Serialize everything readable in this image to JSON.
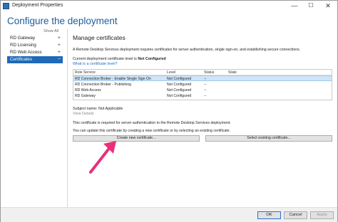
{
  "window": {
    "title": "Deployment Properties",
    "min_glyph": "—",
    "max_glyph": "☐",
    "close_glyph": "✕"
  },
  "page_title": "Configure the deployment",
  "nav": {
    "show_all": "Show All",
    "items": [
      {
        "label": "RD Gateway",
        "glyph": "+"
      },
      {
        "label": "RD Licensing",
        "glyph": "+"
      },
      {
        "label": "RD Web Access",
        "glyph": "+"
      },
      {
        "label": "Certificates",
        "glyph": "−"
      }
    ]
  },
  "main": {
    "section_title": "Manage certificates",
    "description": "A Remote Desktop Services deployment requires certificates for server authentication, single sign-on, and establishing secure connections.",
    "level_prefix": "Current deployment certificate level is",
    "level_value": "Not Configured",
    "level_link": "What is a certificate level?",
    "table": {
      "headers": [
        "Role Service",
        "Level",
        "Status",
        "State"
      ],
      "rows": [
        {
          "role": "RD Connection Broker - Enable Single Sign On",
          "level": "Not Configured",
          "status": "--",
          "state": ""
        },
        {
          "role": "RD Connection Broker - Publishing",
          "level": "Not Configured",
          "status": "--",
          "state": ""
        },
        {
          "role": "RD Web Access",
          "level": "Not Configured",
          "status": "--",
          "state": ""
        },
        {
          "role": "RD Gateway",
          "level": "Not Configured",
          "status": "--",
          "state": ""
        }
      ]
    },
    "subject": "Subject name: Not Applicable",
    "view_details": "View Details",
    "note1": "This certificate is required for server authentication to the Remote Desktop Services deployment.",
    "note2": "You can update this certificate by creating a new certificate or by selecting an existing certificate.",
    "create_button": "Create new certificate...",
    "select_button": "Select existing certificate..."
  },
  "footer": {
    "ok": "OK",
    "cancel": "Cancel",
    "apply": "Apply"
  },
  "colors": {
    "accent": "#1e6ab8",
    "title_blue": "#1c5d99",
    "arrow": "#e8307a",
    "selected_row": "#cfe5f7"
  }
}
